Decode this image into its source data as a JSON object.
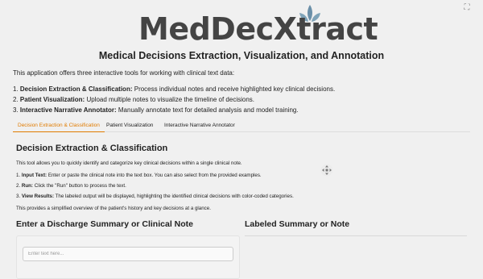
{
  "header": {
    "logo_text": "MedDecXtract",
    "subtitle": "Medical Decisions Extraction, Visualization, and Annotation",
    "expand_icon": "expand-icon"
  },
  "intro": "This application offers three interactive tools for working with clinical text data:",
  "tools": [
    {
      "num": "1.",
      "name": "Decision Extraction & Classification:",
      "desc": "Process individual notes and receive highlighted key clinical decisions."
    },
    {
      "num": "2.",
      "name": "Patient Visualization:",
      "desc": "Upload multiple notes to visualize the timeline of decisions."
    },
    {
      "num": "3.",
      "name": "Interactive Narrative Annotator:",
      "desc": "Manually annotate text for detailed analysis and model training."
    }
  ],
  "tabs": [
    {
      "label": "Decision Extraction & Classification",
      "active": true
    },
    {
      "label": "Patient Visualization",
      "active": false
    },
    {
      "label": "Interactive Narrative Annotator",
      "active": false
    }
  ],
  "section": {
    "title": "Decision Extraction & Classification",
    "description": "This tool allows you to quickly identify and categorize key clinical decisions within a single clinical note.",
    "steps": [
      {
        "num": "1.",
        "name": "Input Text:",
        "desc": "Enter or paste the clinical note into the text box. You can also select from the provided examples."
      },
      {
        "num": "2.",
        "name": "Run:",
        "desc": "Click the \"Run\" button to process the text."
      },
      {
        "num": "3.",
        "name": "View Results:",
        "desc": "The labeled output will be displayed, highlighting the identified clinical decisions with color-coded categories."
      }
    ],
    "overview": "This provides a simplified overview of the patient's history and key decisions at a glance.",
    "move_icon": "move-icon"
  },
  "input_panel": {
    "title": "Enter a Discharge Summary or Clinical Note",
    "placeholder": "Enter text here..."
  },
  "output_panel": {
    "title": "Labeled Summary or Note"
  },
  "colors": {
    "accent": "#e07b00",
    "logo_text": "#444444",
    "logo_leaf": "#6a8fa8"
  }
}
